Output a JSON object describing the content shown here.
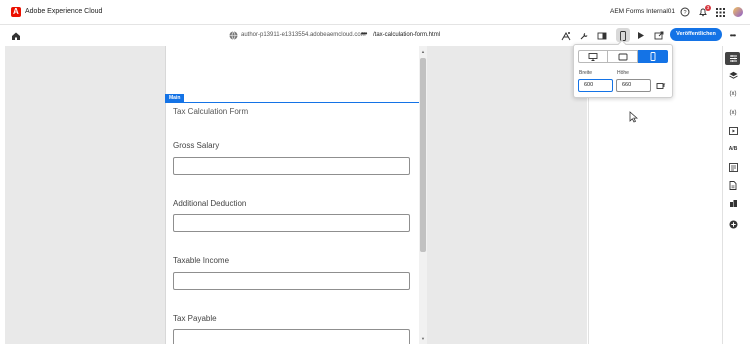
{
  "shell": {
    "app_title": "Adobe Experience Cloud",
    "org_name": "AEM Forms Internal01",
    "notification_count": "3"
  },
  "header": {
    "url": "author-p13911-e1313554.adobeaemcloud.com",
    "more": "•••",
    "path": "/tax-calculation-form.html",
    "publish_label": "Veröffentlichen",
    "overflow": "•••"
  },
  "canvas": {
    "main_tag": "Main",
    "form_title": "Tax Calculation Form",
    "fields": [
      {
        "label": "Gross Salary",
        "value": ""
      },
      {
        "label": "Additional Deduction",
        "value": ""
      },
      {
        "label": "Taxable Income",
        "value": ""
      },
      {
        "label": "Tax Payable",
        "value": ""
      }
    ]
  },
  "device_popover": {
    "width_label": "Breite",
    "height_label": "Höhe",
    "width_value": "600",
    "height_value": "660",
    "selected_device": "mobile"
  },
  "rail": {
    "items": [
      "properties",
      "layers",
      "(x)",
      "(x)",
      "media",
      "A/B",
      "form",
      "document",
      "assets",
      "add"
    ]
  },
  "colors": {
    "accent": "#1473e6",
    "adobe_red": "#eb1000",
    "badge": "#d7373f"
  }
}
